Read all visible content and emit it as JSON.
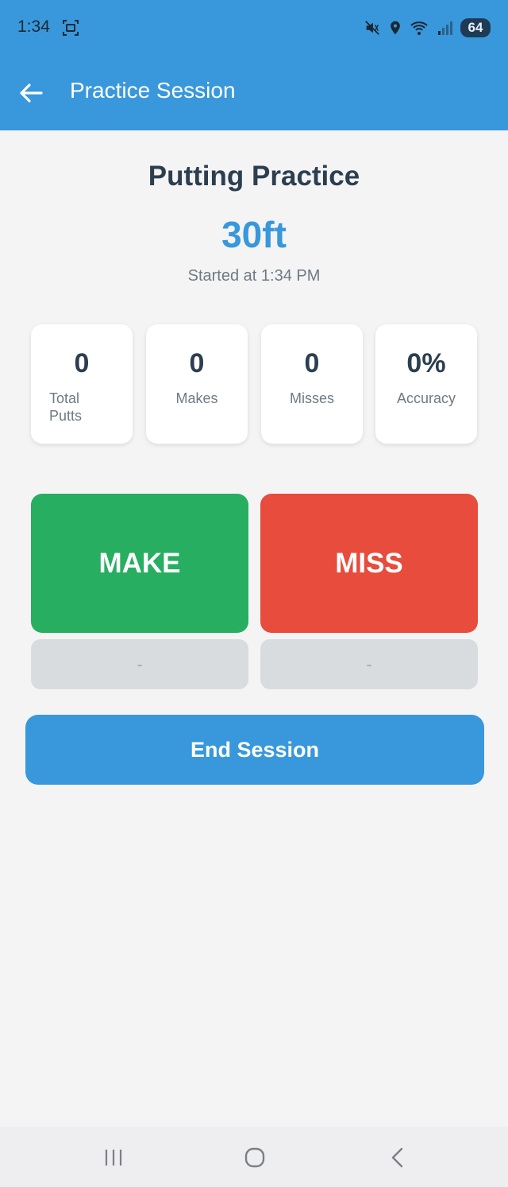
{
  "status_bar": {
    "time": "1:34",
    "battery": "64",
    "icons": [
      "screenshot-icon",
      "mute-icon",
      "location-icon",
      "wifi-icon",
      "signal-icon",
      "battery-icon"
    ]
  },
  "app_bar": {
    "title": "Practice Session",
    "back_icon": "arrow-left-icon"
  },
  "session": {
    "title": "Putting Practice",
    "distance": "30ft",
    "started": "Started at 1:34 PM"
  },
  "stats": [
    {
      "value": "0",
      "label": "Total Putts"
    },
    {
      "value": "0",
      "label": "Makes"
    },
    {
      "value": "0",
      "label": "Misses"
    },
    {
      "value": "0%",
      "label": "Accuracy"
    }
  ],
  "actions": {
    "make_label": "MAKE",
    "miss_label": "MISS",
    "make_sub": "-",
    "miss_sub": "-",
    "end_label": "End Session"
  },
  "colors": {
    "primary": "#3898db",
    "make": "#27ae60",
    "miss": "#e74c3c",
    "text_dark": "#2c3e50",
    "background": "#f4f4f5"
  },
  "nav_bar": {
    "icons": [
      "recent-apps-icon",
      "home-icon",
      "back-icon"
    ]
  }
}
